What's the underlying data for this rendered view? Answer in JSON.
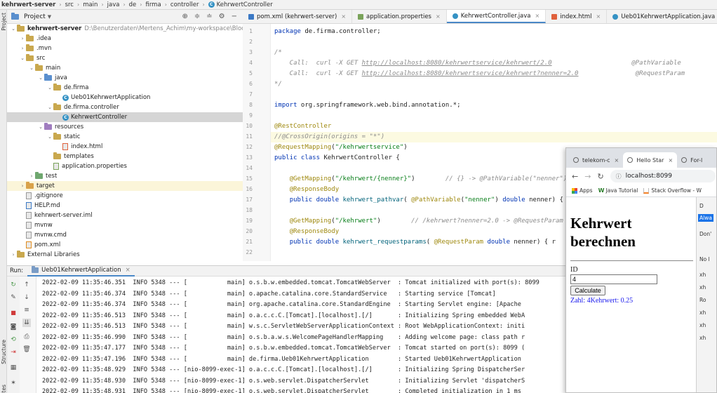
{
  "breadcrumb": [
    "kehrwert-server",
    "src",
    "main",
    "java",
    "de",
    "firma",
    "controller",
    "KehrwertController"
  ],
  "sidebar_tabs": {
    "project": "Project",
    "structure": "Structure",
    "favorites": "Favorites"
  },
  "project_panel": {
    "title": "Project",
    "tree": [
      {
        "label": "kehrwert-server",
        "path": "D:\\Benutzerdaten\\Mertens_Achim\\my-workspace\\Block9-mode",
        "icon": "folder",
        "depth": 0,
        "expanded": true
      },
      {
        "label": ".idea",
        "icon": "folder",
        "depth": 1,
        "expanded": false
      },
      {
        "label": ".mvn",
        "icon": "folder",
        "depth": 1,
        "expanded": false
      },
      {
        "label": "src",
        "icon": "folder",
        "depth": 1,
        "expanded": true
      },
      {
        "label": "main",
        "icon": "folder",
        "depth": 2,
        "expanded": true
      },
      {
        "label": "java",
        "icon": "folder-blue",
        "depth": 3,
        "expanded": true
      },
      {
        "label": "de.firma",
        "icon": "folder",
        "depth": 4,
        "expanded": true
      },
      {
        "label": "Ueb01KehrwertApplication",
        "icon": "class",
        "depth": 5
      },
      {
        "label": "de.firma.controller",
        "icon": "folder",
        "depth": 4,
        "expanded": true
      },
      {
        "label": "KehrwertController",
        "icon": "class",
        "depth": 5,
        "selected": true
      },
      {
        "label": "resources",
        "icon": "folder-res",
        "depth": 3,
        "expanded": true
      },
      {
        "label": "static",
        "icon": "folder",
        "depth": 4,
        "expanded": true
      },
      {
        "label": "index.html",
        "icon": "html",
        "depth": 5
      },
      {
        "label": "templates",
        "icon": "folder",
        "depth": 4
      },
      {
        "label": "application.properties",
        "icon": "props",
        "depth": 4
      },
      {
        "label": "test",
        "icon": "folder-test",
        "depth": 2,
        "expanded": false
      },
      {
        "label": "target",
        "icon": "folder-orange",
        "depth": 1,
        "expanded": false,
        "highlight": true
      },
      {
        "label": ".gitignore",
        "icon": "file",
        "depth": 1
      },
      {
        "label": "HELP.md",
        "icon": "md",
        "depth": 1
      },
      {
        "label": "kehrwert-server.iml",
        "icon": "file",
        "depth": 1
      },
      {
        "label": "mvnw",
        "icon": "file",
        "depth": 1
      },
      {
        "label": "mvnw.cmd",
        "icon": "file",
        "depth": 1
      },
      {
        "label": "pom.xml",
        "icon": "xml",
        "depth": 1
      },
      {
        "label": "External Libraries",
        "icon": "lib",
        "depth": 0,
        "expanded": false
      }
    ]
  },
  "editor": {
    "tabs": [
      {
        "label": "pom.xml (kehrwert-server)",
        "icon": "m",
        "active": false
      },
      {
        "label": "application.properties",
        "icon": "props",
        "active": false
      },
      {
        "label": "KehrwertController.java",
        "icon": "class",
        "active": true
      },
      {
        "label": "index.html",
        "icon": "html",
        "active": false
      },
      {
        "label": "Ueb01KehrwertApplication.java",
        "icon": "class",
        "active": false
      }
    ],
    "lines": [
      {
        "n": "1",
        "html": "<span class=\"kw\">package</span> de.firma.controller;"
      },
      {
        "n": "2",
        "html": ""
      },
      {
        "n": "3",
        "html": "<span class=\"cm\">/*</span>"
      },
      {
        "n": "4",
        "html": "<span class=\"cm\">    Call:  curl -X GET </span><span class=\"lk\">http://localhost:8080/kehrwertservice/kehrwert/2.0</span><span class=\"cm\">                     @PathVariable</span>"
      },
      {
        "n": "5",
        "html": "<span class=\"cm\">    Call:  curl -X GET </span><span class=\"lk\">http://localhost:8080/kehrwertservice/kehrwert?nenner=2.0</span><span class=\"cm\">               @RequestParam</span>"
      },
      {
        "n": "6",
        "html": "<span class=\"cm\">*/</span>"
      },
      {
        "n": "7",
        "html": ""
      },
      {
        "n": "8",
        "html": "<span class=\"kw\">import</span> org.springframework.web.bind.annotation.*;"
      },
      {
        "n": "9",
        "html": ""
      },
      {
        "n": "10",
        "html": "<span class=\"an\">@RestController</span>"
      },
      {
        "n": "11",
        "html": "<span class=\"cm\">//@CrossOrigin(origins = \"*\")</span>",
        "highlight": true
      },
      {
        "n": "12",
        "html": "<span class=\"an\">@RequestMapping</span>(<span class=\"st\">\"/kehrwertservice\"</span>)"
      },
      {
        "n": "13",
        "html": "<span class=\"kw\">public class</span> KehrwertController {"
      },
      {
        "n": "14",
        "html": ""
      },
      {
        "n": "15",
        "html": "    <span class=\"an\">@GetMapping</span>(<span class=\"st\">\"/kehrwert/{nenner}\"</span>)        <span class=\"cm\">// {} -> @PathVariable(\"nenner\")</span>"
      },
      {
        "n": "16",
        "html": "    <span class=\"an\">@ResponseBody</span>"
      },
      {
        "n": "17",
        "html": "    <span class=\"kw\">public double</span> <span class=\"fn\">kehrwert_pathvar</span>( <span class=\"an\">@PathVariable</span>(<span class=\"st\">\"nenner\"</span>) <span class=\"kw\">double</span> nenner) {"
      },
      {
        "n": "18",
        "html": ""
      },
      {
        "n": "19",
        "html": "    <span class=\"an\">@GetMapping</span>(<span class=\"st\">\"/kehrwert\"</span>)        <span class=\"cm\">// /kehrwert?nenner=2.0 -> @RequestParam</span>"
      },
      {
        "n": "20",
        "html": "    <span class=\"an\">@ResponseBody</span>"
      },
      {
        "n": "21",
        "html": "    <span class=\"kw\">public double</span> <span class=\"fn\">kehrwert_requestparams</span>( <span class=\"an\">@RequestParam</span> <span class=\"kw\">double</span> nenner) { r"
      },
      {
        "n": "22",
        "html": ""
      }
    ]
  },
  "run_panel": {
    "label": "Run:",
    "tab": "Ueb01KehrwertApplication",
    "logs": [
      "2022-02-09 11:35:46.351  INFO 5348 --- [           main] o.s.b.w.embedded.tomcat.TomcatWebServer  : Tomcat initialized with port(s): 8099",
      "2022-02-09 11:35:46.374  INFO 5348 --- [           main] o.apache.catalina.core.StandardService   : Starting service [Tomcat]",
      "2022-02-09 11:35:46.374  INFO 5348 --- [           main] org.apache.catalina.core.StandardEngine  : Starting Servlet engine: [Apache",
      "2022-02-09 11:35:46.513  INFO 5348 --- [           main] o.a.c.c.C.[Tomcat].[localhost].[/]       : Initializing Spring embedded WebA",
      "2022-02-09 11:35:46.513  INFO 5348 --- [           main] w.s.c.ServletWebServerApplicationContext : Root WebApplicationContext: initi",
      "2022-02-09 11:35:46.990  INFO 5348 --- [           main] o.s.b.a.w.s.WelcomePageHandlerMapping    : Adding welcome page: class path r",
      "2022-02-09 11:35:47.177  INFO 5348 --- [           main] o.s.b.w.embedded.tomcat.TomcatWebServer  : Tomcat started on port(s): 8099 (",
      "2022-02-09 11:35:47.196  INFO 5348 --- [           main] de.firma.Ueb01KehrwertApplication        : Started Ueb01KehrwertApplication",
      "2022-02-09 11:35:48.929  INFO 5348 --- [nio-8099-exec-1] o.a.c.c.C.[Tomcat].[localhost].[/]       : Initializing Spring DispatcherSer",
      "2022-02-09 11:35:48.930  INFO 5348 --- [nio-8099-exec-1] o.s.web.servlet.DispatcherServlet        : Initializing Servlet 'dispatcherS",
      "2022-02-09 11:35:48.931  INFO 5348 --- [nio-8099-exec-1] o.s.web.servlet.DispatcherServlet        : Completed initialization in 1 ms"
    ]
  },
  "browser": {
    "tabs": [
      {
        "label": "telekom-c",
        "active": false
      },
      {
        "label": "Hello Star",
        "active": true
      },
      {
        "label": "For-l",
        "active": false
      }
    ],
    "address": "localhost:8099",
    "bookmarks": [
      "Apps",
      "Java Tutorial",
      "Stack Overflow - W"
    ],
    "page": {
      "heading": "Kehrwert berechnen",
      "id_label": "ID",
      "input_value": "4",
      "button_label": "Calculate",
      "result": "Zahl: 4Kehrwert: 0.25"
    },
    "devtools": [
      "D",
      "Alwa",
      "Don'",
      "No l",
      "xh",
      "xh",
      "Ro",
      "xh",
      "xh",
      "xh"
    ]
  },
  "colors": {
    "accent": "#4a88c7",
    "selection": "#d5d5d5",
    "result_text": "#1a1aee"
  }
}
